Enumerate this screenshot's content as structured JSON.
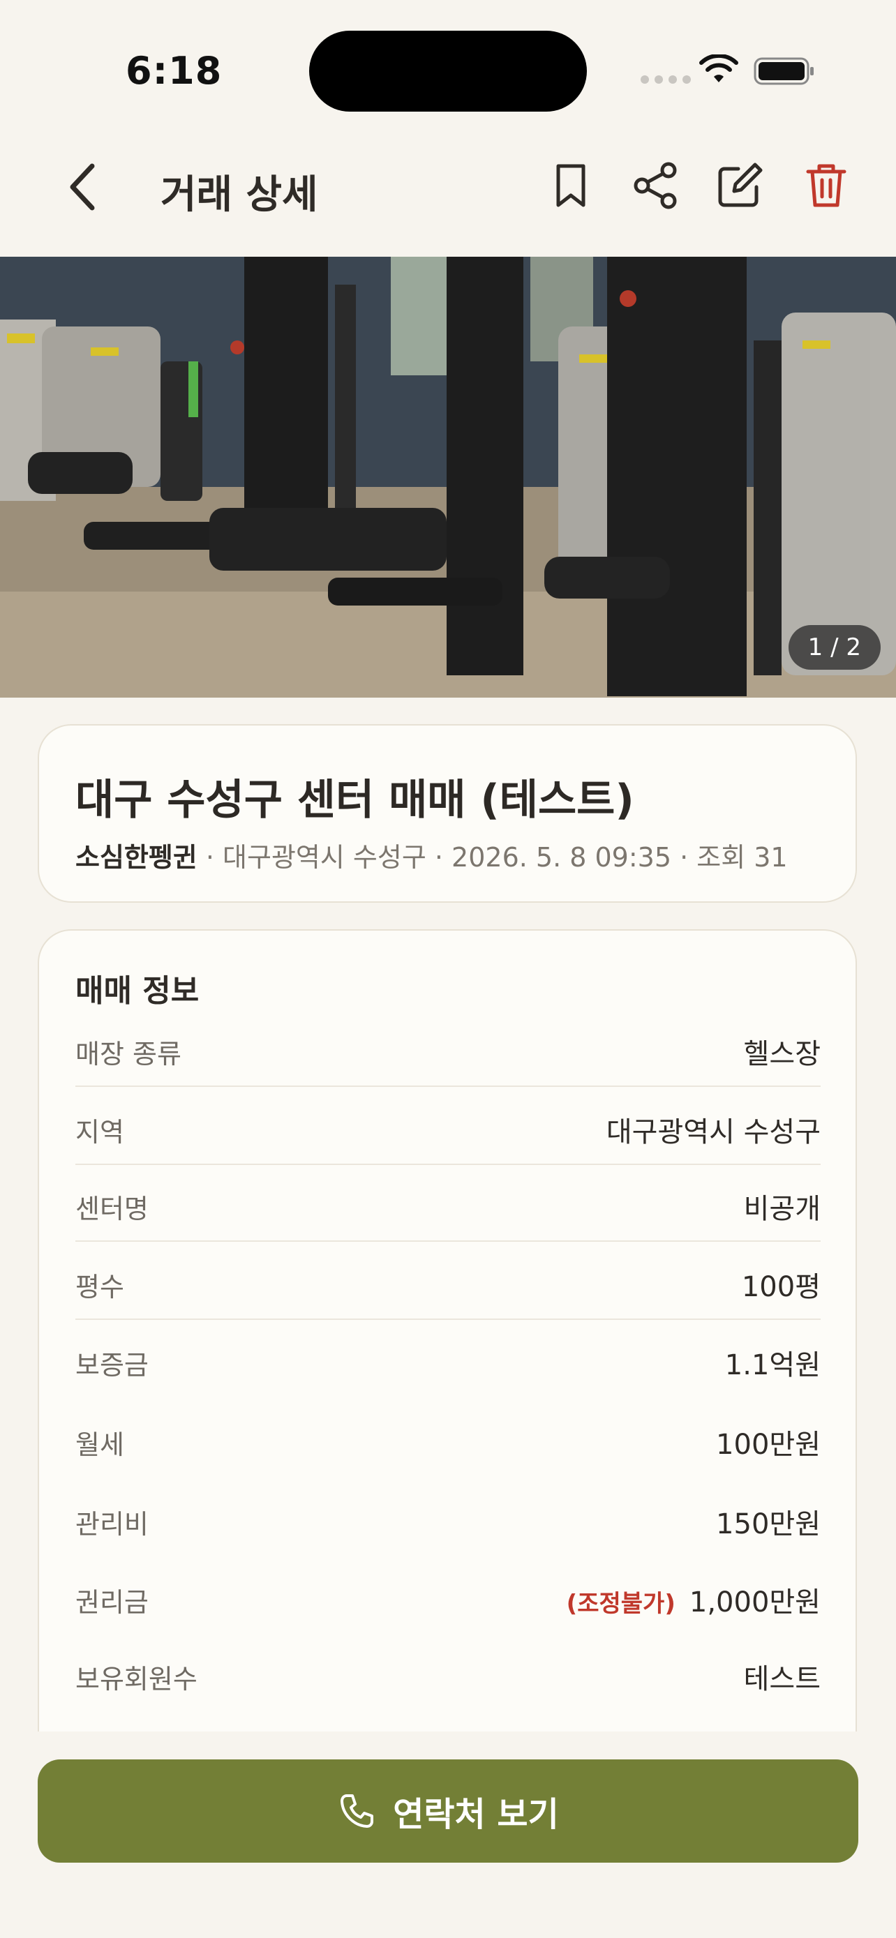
{
  "status_bar": {
    "time": "6:18"
  },
  "header": {
    "title": "거래 상세"
  },
  "photo": {
    "counter": "1 / 2"
  },
  "listing": {
    "title": "대구 수성구 센터 매매 (테스트)",
    "author": "소심한펭귄",
    "meta": " · 대구광역시 수성구 · 2026. 5. 8 09:35 · 조회 31"
  },
  "info": {
    "section_title": "매매 정보",
    "rows": [
      {
        "label": "매장 종류",
        "value": "헬스장",
        "note": ""
      },
      {
        "label": "지역",
        "value": "대구광역시 수성구",
        "note": ""
      },
      {
        "label": "센터명",
        "value": "비공개",
        "note": ""
      },
      {
        "label": "평수",
        "value": "100평",
        "note": ""
      },
      {
        "label": "보증금",
        "value": "1.1억원",
        "note": ""
      },
      {
        "label": "월세",
        "value": "100만원",
        "note": ""
      },
      {
        "label": "관리비",
        "value": "150만원",
        "note": ""
      },
      {
        "label": "권리금",
        "value": "1,000만원",
        "note": "(조정불가)"
      },
      {
        "label": "보유회원수",
        "value": "테스트",
        "note": ""
      }
    ]
  },
  "cta": {
    "label": "연락처 보기"
  },
  "icons": {
    "back": "chevron-left-icon",
    "bookmark": "bookmark-icon",
    "share": "share-icon",
    "edit": "edit-icon",
    "delete": "trash-icon",
    "phone": "phone-icon"
  },
  "colors": {
    "accent": "#737f36",
    "danger": "#c0382b",
    "background": "#f7f4ee"
  }
}
